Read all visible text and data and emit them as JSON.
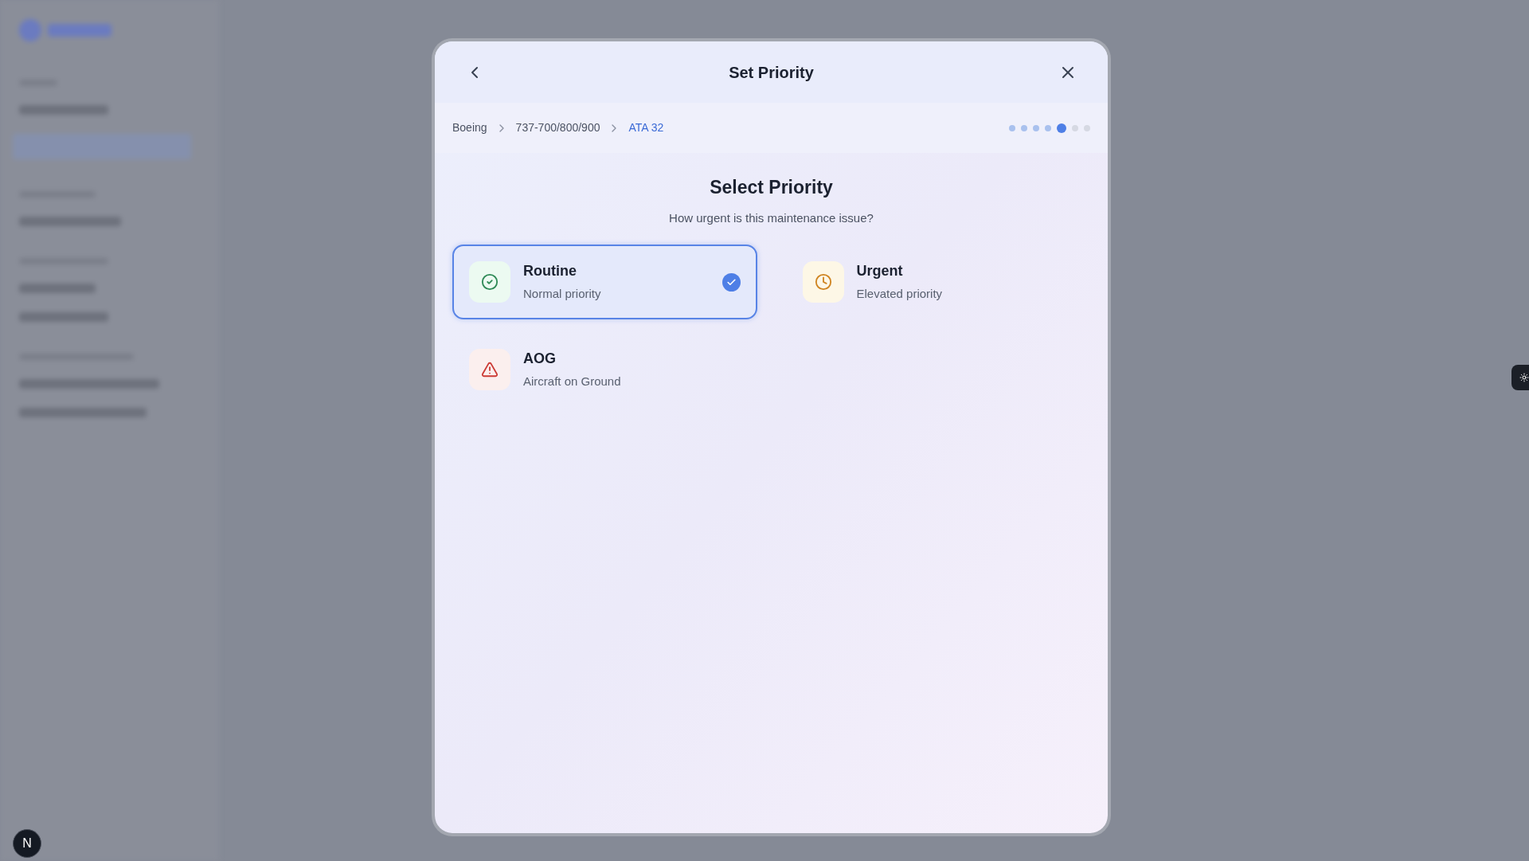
{
  "dialog": {
    "title": "Set Priority",
    "breadcrumb": [
      {
        "label": "Boeing",
        "selected": false
      },
      {
        "label": "737-700/800/900",
        "selected": false
      },
      {
        "label": "ATA 32",
        "selected": true
      }
    ],
    "steps": [
      {
        "completed": true,
        "selected": false
      },
      {
        "completed": true,
        "selected": false
      },
      {
        "completed": true,
        "selected": false
      },
      {
        "completed": true,
        "selected": false
      },
      {
        "completed": false,
        "selected": true
      },
      {
        "completed": false,
        "selected": false
      },
      {
        "completed": false,
        "selected": false
      }
    ],
    "heading": "Select Priority",
    "subheading": "How urgent is this maintenance issue?",
    "options": [
      {
        "kind": "check",
        "label": "Routine",
        "description": "Normal priority",
        "selected": true
      },
      {
        "kind": "clock",
        "label": "Urgent",
        "description": "Elevated priority",
        "selected": false
      },
      {
        "kind": "alert",
        "label": "AOG",
        "description": "Aircraft on Ground",
        "selected": false
      }
    ]
  },
  "dev_badge": {
    "label": "N"
  }
}
